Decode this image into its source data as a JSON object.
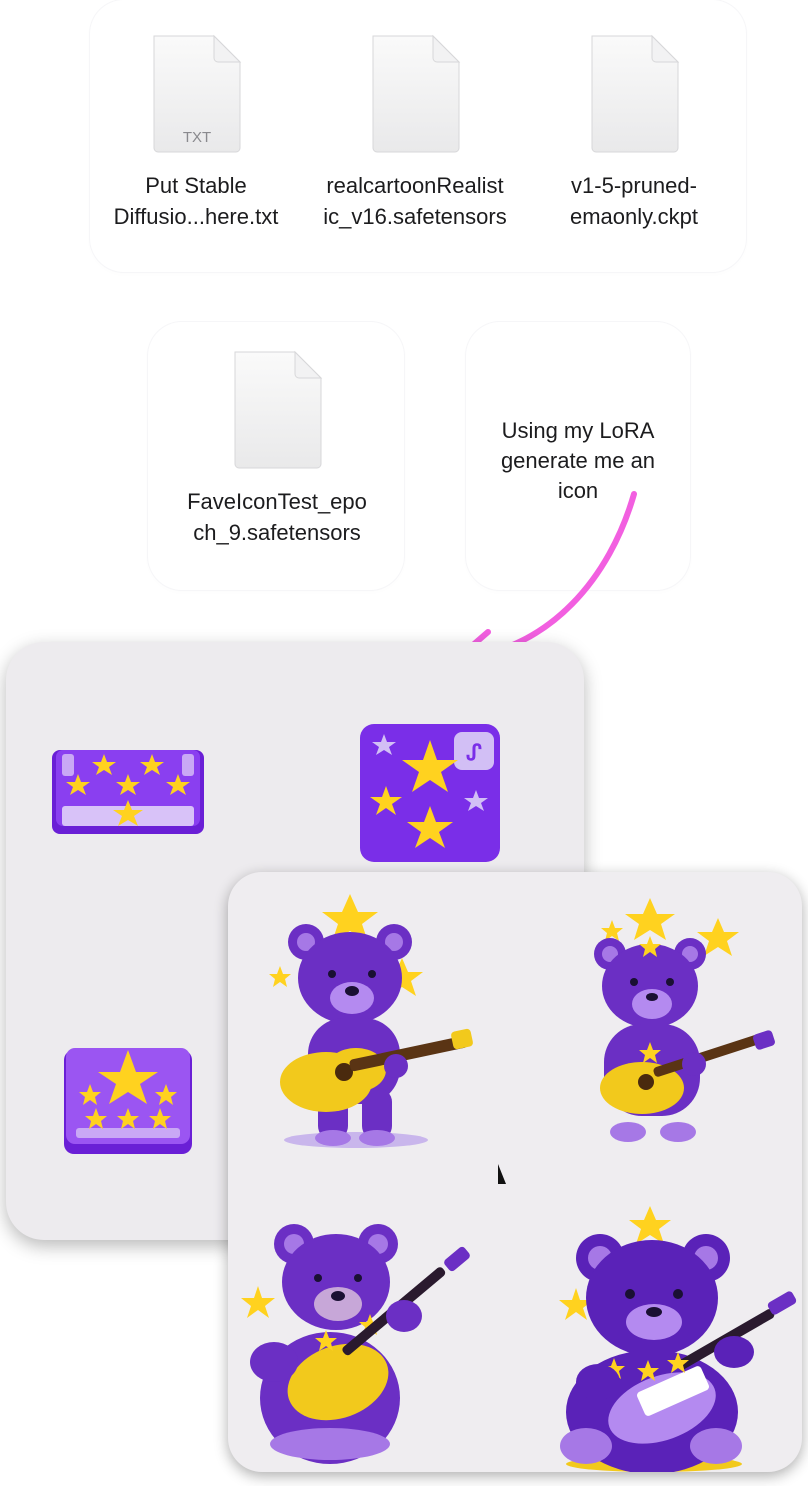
{
  "files_row1": [
    {
      "name": "Put Stable\nDiffusio...here.txt",
      "badge": "TXT"
    },
    {
      "name": "realcartoonRealist\nic_v16.safetensors",
      "badge": ""
    },
    {
      "name": "v1-5-pruned-\nemaonly.ckpt",
      "badge": ""
    }
  ],
  "files_row2": [
    {
      "name": "FaveIconTest_epo\nch_9.safetensors",
      "badge": ""
    }
  ],
  "prompt_note": "Using my LoRA\ngenerate me an\nicon",
  "colors": {
    "accent_arrow": "#f25fe0",
    "icon_purple": "#7a2ee8",
    "icon_purple_light": "#c9a8f5",
    "star_yellow": "#ffd21f",
    "bear_purple": "#6b2fc4",
    "card_bg": "#edebee"
  },
  "generated_icons": [
    {
      "name": "star-keyboard-icon"
    },
    {
      "name": "star-app-icon"
    },
    {
      "name": "star-tray-icon"
    }
  ],
  "generated_bears": [
    {
      "name": "bear-guitar-1"
    },
    {
      "name": "bear-guitar-2"
    },
    {
      "name": "bear-guitar-3"
    },
    {
      "name": "bear-guitar-4"
    }
  ]
}
